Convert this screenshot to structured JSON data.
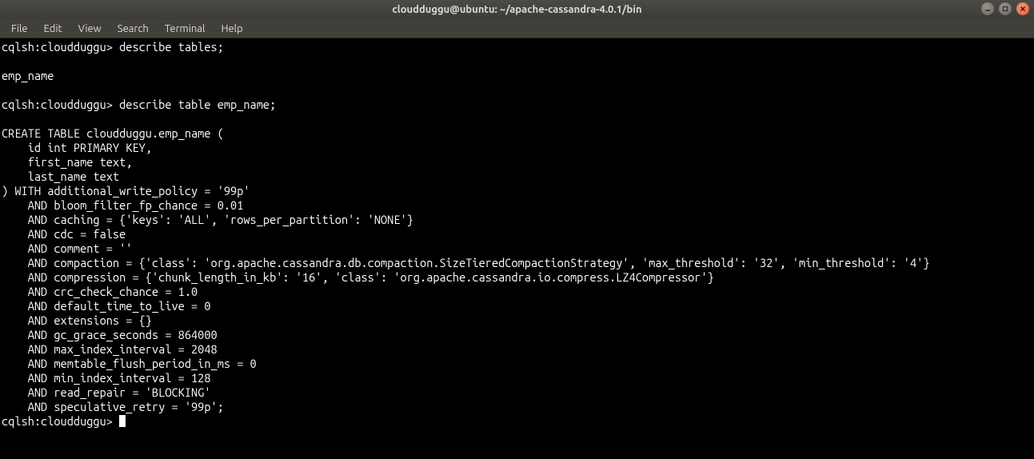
{
  "window": {
    "title": "cloudduggu@ubuntu: ~/apache-cassandra-4.0.1/bin"
  },
  "menu": {
    "file": "File",
    "edit": "Edit",
    "view": "View",
    "search": "Search",
    "terminal": "Terminal",
    "help": "Help"
  },
  "terminal": {
    "line1": "cqlsh:cloudduggu> describe tables;",
    "line2": "",
    "line3": "emp_name",
    "line4": "",
    "line5": "cqlsh:cloudduggu> describe table emp_name;",
    "line6": "",
    "line7": "CREATE TABLE cloudduggu.emp_name (",
    "line8": "    id int PRIMARY KEY,",
    "line9": "    first_name text,",
    "line10": "    last_name text",
    "line11": ") WITH additional_write_policy = '99p'",
    "line12": "    AND bloom_filter_fp_chance = 0.01",
    "line13": "    AND caching = {'keys': 'ALL', 'rows_per_partition': 'NONE'}",
    "line14": "    AND cdc = false",
    "line15": "    AND comment = ''",
    "line16": "    AND compaction = {'class': 'org.apache.cassandra.db.compaction.SizeTieredCompactionStrategy', 'max_threshold': '32', 'min_threshold': '4'}",
    "line17": "    AND compression = {'chunk_length_in_kb': '16', 'class': 'org.apache.cassandra.io.compress.LZ4Compressor'}",
    "line18": "    AND crc_check_chance = 1.0",
    "line19": "    AND default_time_to_live = 0",
    "line20": "    AND extensions = {}",
    "line21": "    AND gc_grace_seconds = 864000",
    "line22": "    AND max_index_interval = 2048",
    "line23": "    AND memtable_flush_period_in_ms = 0",
    "line24": "    AND min_index_interval = 128",
    "line25": "    AND read_repair = 'BLOCKING'",
    "line26": "    AND speculative_retry = '99p';",
    "line27": "cqlsh:cloudduggu> "
  }
}
